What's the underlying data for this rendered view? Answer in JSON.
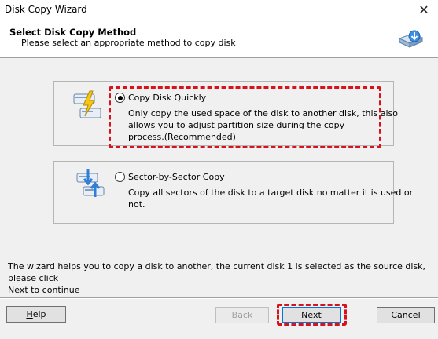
{
  "window": {
    "title": "Disk Copy Wizard",
    "close_glyph": "✕"
  },
  "header": {
    "title": "Select Disk Copy Method",
    "subtitle": "Please select an appropriate method to copy disk",
    "icon": "disk-copy-icon"
  },
  "options": [
    {
      "label": "Copy Disk Quickly",
      "description_lines": [
        "Only copy the used space of the disk to another disk, this also",
        "allows you to adjust partition size during the copy",
        "process.(Recommended)"
      ],
      "selected": true,
      "icon": "disk-lightning-icon"
    },
    {
      "label": "Sector-by-Sector Copy",
      "description_lines": [
        "Copy all sectors of the disk to a target disk no matter it is used or",
        "not."
      ],
      "selected": false,
      "icon": "disk-sector-icon"
    }
  ],
  "info": {
    "lines": [
      "The wizard helps you to copy a disk to another, the current disk 1 is selected as the source disk, please click",
      "Next to continue"
    ]
  },
  "buttons": {
    "help": {
      "label": "Help",
      "underline": "H",
      "rest": "elp"
    },
    "back": {
      "label": "Back",
      "underline": "B",
      "rest": "ack",
      "enabled": false
    },
    "next": {
      "label": "Next",
      "underline": "N",
      "rest": "ext"
    },
    "cancel": {
      "label": "Cancel",
      "underline": "C",
      "rest": "ancel"
    }
  },
  "colors": {
    "highlight": "#d8121b",
    "panel": "#f0f0f0",
    "accent": "#0078d7"
  }
}
